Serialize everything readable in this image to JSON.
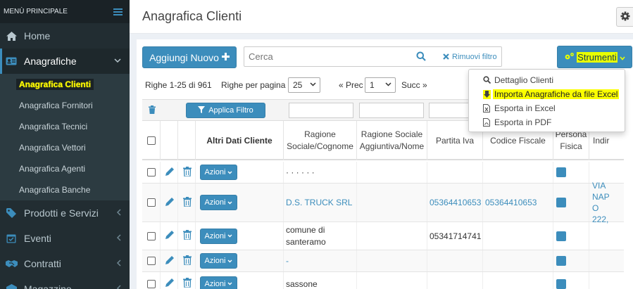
{
  "sidebar": {
    "header": "MENÙ PRINCIPALE",
    "items": [
      {
        "label": "Home"
      },
      {
        "label": "Anagrafiche"
      },
      {
        "label": "Prodotti e Servizi"
      },
      {
        "label": "Eventi"
      },
      {
        "label": "Contratti"
      },
      {
        "label": "Magazzino"
      }
    ],
    "submenu": [
      {
        "label": "Anagrafica Clienti"
      },
      {
        "label": "Anagrafica Fornitori"
      },
      {
        "label": "Anagrafica Tecnici"
      },
      {
        "label": "Anagrafica Vettori"
      },
      {
        "label": "Anagrafica Agenti"
      },
      {
        "label": "Anagrafica Banche"
      }
    ]
  },
  "page": {
    "title": "Anagrafica Clienti"
  },
  "toolbar": {
    "add_label": "Aggiungi Nuovo",
    "search_placeholder": "Cerca",
    "remove_filter_label": "Rimuovi filtro",
    "tools_label": "Strumenti"
  },
  "pagination": {
    "rows_info": "Righe 1-25 di 961",
    "rows_per_page_label": "Righe per pagina",
    "rows_per_page_value": "25",
    "prev_label": "« Prec",
    "page_value": "1",
    "next_label": "Succ »"
  },
  "table": {
    "apply_filter_label": "Applica Filtro",
    "headers": {
      "altri_dati": "Altri Dati Cliente",
      "ragione_sociale": "Ragione Sociale/Cognome",
      "ragione_sociale_agg": "Ragione Sociale Aggiuntiva/Nome",
      "partita_iva": "Partita Iva",
      "codice_fiscale": "Codice Fiscale",
      "persona_fisica": "Persona Fisica",
      "indirizzo": "Indir"
    },
    "actions_label": "Azioni",
    "rows": [
      {
        "ragione_sociale": "·  ·  ·  ·  ·  ·",
        "ragione_sociale_agg": "",
        "partita_iva": "",
        "codice_fiscale": "",
        "indirizzo": ""
      },
      {
        "ragione_sociale": "D.S. TRUCK SRL",
        "ragione_sociale_agg": "",
        "partita_iva": "05364410653",
        "codice_fiscale": "05364410653",
        "indirizzo": "VIA NAPO 222,"
      },
      {
        "ragione_sociale": "comune di santeramo",
        "ragione_sociale_agg": "",
        "partita_iva": "05341714741",
        "codice_fiscale": "",
        "indirizzo": ""
      },
      {
        "ragione_sociale": "-",
        "ragione_sociale_agg": "",
        "partita_iva": "",
        "codice_fiscale": "",
        "indirizzo": ""
      },
      {
        "ragione_sociale": "sassone",
        "ragione_sociale_agg": "",
        "partita_iva": "",
        "codice_fiscale": "",
        "indirizzo": ""
      }
    ]
  },
  "tools_menu": [
    {
      "label": "Dettaglio Clienti",
      "icon": "search-icon"
    },
    {
      "label": "Importa Anagrafiche da file Excel",
      "icon": "import-icon"
    },
    {
      "label": "Esporta in Excel",
      "icon": "excel-file-icon"
    },
    {
      "label": "Esporta in PDF",
      "icon": "pdf-file-icon"
    }
  ],
  "colors": {
    "accent": "#3c8dbc",
    "sidebar": "#222d32",
    "highlight": "#fbff00"
  }
}
